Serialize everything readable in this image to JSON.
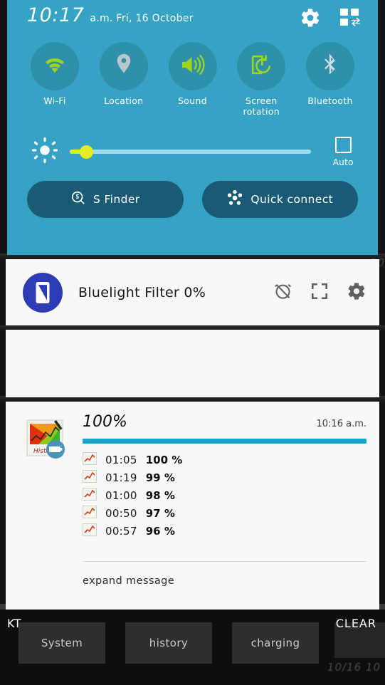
{
  "statusbar": {
    "time": "10:17",
    "meta": "a.m. Fri, 16 October",
    "settings_icon": "gear-icon",
    "edit_icon": "quick-settings-edit-icon"
  },
  "quick_settings": {
    "toggles": [
      {
        "label": "Wi-Fi",
        "icon": "wifi-icon",
        "active": true
      },
      {
        "label": "Location",
        "icon": "location-pin-icon",
        "active": false
      },
      {
        "label": "Sound",
        "icon": "speaker-icon",
        "active": true
      },
      {
        "label": "Screen\nrotation",
        "icon": "screen-rotation-icon",
        "active": true
      },
      {
        "label": "Bluetooth",
        "icon": "bluetooth-icon",
        "active": false
      }
    ],
    "brightness": {
      "icon": "brightness-sun-icon",
      "value_percent": 4,
      "auto_label": "Auto",
      "auto_checked": false
    },
    "buttons": [
      {
        "label": "S Finder",
        "icon": "s-finder-icon"
      },
      {
        "label": "Quick connect",
        "icon": "quick-connect-icon"
      }
    ]
  },
  "notifications": {
    "bluelight": {
      "title": "Bluelight Filter 0%",
      "app_icon": "bluelight-phone-icon",
      "actions": [
        {
          "icon": "alarm-off-icon"
        },
        {
          "icon": "expand-brackets-icon"
        },
        {
          "icon": "gear-icon"
        }
      ]
    },
    "battery": {
      "app_icon": "history-chart-icon",
      "app_icon_label": "History",
      "badge_icon": "battery-badge-icon",
      "percent": "100%",
      "time": "10:16 a.m.",
      "progress_percent": 100,
      "progress_color": "#18a2cd",
      "rows": [
        {
          "icon": "chart-line-icon",
          "time": "01:05",
          "percent": "100 %"
        },
        {
          "icon": "chart-line-icon",
          "time": "01:19",
          "percent": "99 %"
        },
        {
          "icon": "chart-line-icon",
          "time": "01:00",
          "percent": "98 %"
        },
        {
          "icon": "chart-line-icon",
          "time": "00:50",
          "percent": "97 %"
        },
        {
          "icon": "chart-line-icon",
          "time": "00:57",
          "percent": "96 %"
        }
      ],
      "expand_label": "expand message"
    }
  },
  "bottom": {
    "carrier": "KT",
    "clear_label": "CLEAR",
    "tiles": [
      {
        "label": "System"
      },
      {
        "label": "history"
      },
      {
        "label": "charging"
      }
    ],
    "ghost_date": "10/16 10"
  },
  "colors": {
    "panel_bg": "#36a2c4",
    "toggle_circle": "#2f90ab",
    "accent_green": "#9ed41a",
    "inactive_gray": "#b9c6cc",
    "finder_btn": "#1a5a74",
    "slider_thumb": "#e6ec21",
    "bluelight_icon": "#2d3bb4"
  }
}
